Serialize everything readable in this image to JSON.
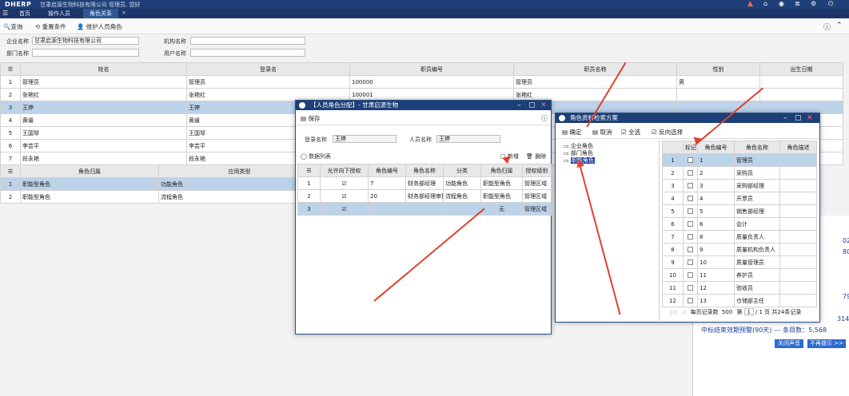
{
  "app": {
    "logo": "DHERP",
    "company": "甘肃启源生物科技有限公司",
    "user": "管理员, 您好"
  },
  "nav_tabs": [
    "首页",
    "操作人员",
    "角色关系"
  ],
  "toolbar": {
    "query": "查询",
    "reset": "重置条件",
    "maintain": "维护人员角色"
  },
  "filters": {
    "company_label": "企业名称",
    "company_value": "甘肃启源生物科技有限公司",
    "org_label": "机构名称",
    "dept_label": "部门名称",
    "user_label": "用户名称"
  },
  "staff_table": {
    "headers": [
      "姓名",
      "登录名",
      "职员编号",
      "职员名称",
      "性别",
      "出生日期"
    ],
    "rows": [
      {
        "n": "1",
        "name": "管理员",
        "login": "管理员",
        "code": "100000",
        "title": "管理员",
        "sex": "男"
      },
      {
        "n": "2",
        "name": "张艳红",
        "login": "张艳红",
        "code": "100001",
        "title": "张艳红",
        "sex": ""
      },
      {
        "n": "3",
        "name": "王婷",
        "login": "王婷",
        "code": "",
        "title": "",
        "sex": ""
      },
      {
        "n": "4",
        "name": "黄瑗",
        "login": "黄瑗",
        "code": "",
        "title": "",
        "sex": ""
      },
      {
        "n": "5",
        "name": "王国琴",
        "login": "王国琴",
        "code": "",
        "title": "",
        "sex": ""
      },
      {
        "n": "6",
        "name": "李芸平",
        "login": "李芸平",
        "code": "",
        "title": "",
        "sex": ""
      },
      {
        "n": "7",
        "name": "段永艳",
        "login": "段永艳",
        "code": "",
        "title": "",
        "sex": ""
      }
    ]
  },
  "role_table": {
    "headers": [
      "角色归属",
      "应用类型"
    ],
    "rows": [
      {
        "n": "1",
        "belong": "职能型角色",
        "app": "功能角色"
      },
      {
        "n": "2",
        "belong": "职能型角色",
        "app": "流程角色"
      }
    ]
  },
  "dialog1": {
    "title": "【人员角色分配】- 甘肃启源生物",
    "save": "保存",
    "login_label": "登录名称",
    "login_value": "王婷",
    "person_label": "人员名称",
    "person_value": "王婷",
    "list_label": "数据列表",
    "add": "新增",
    "del": "删除",
    "headers": [
      "允许向下授权",
      "角色编号",
      "角色名称",
      "分类",
      "角色归属",
      "授权级别"
    ],
    "rows": [
      {
        "n": "1",
        "check": "☑",
        "code": "7",
        "name": "财务部经理",
        "type": "功能角色",
        "belong": "职能型角色",
        "level": "管理区域"
      },
      {
        "n": "2",
        "check": "☑",
        "code": "20",
        "name": "财务部经理审批",
        "type": "流程角色",
        "belong": "职能型角色",
        "level": "管理区域"
      },
      {
        "n": "3",
        "check": "☑",
        "code": "",
        "name": "",
        "type": "",
        "belong": "无",
        "level": "管理区域"
      }
    ]
  },
  "dialog2": {
    "title": "角色资料检索方案",
    "ok": "确定",
    "cancel": "取消",
    "all": "全选",
    "invert": "反向选择",
    "tree": [
      "企业角色",
      "部门角色",
      "职能角色"
    ],
    "headers": [
      "标记",
      "角色编号",
      "角色名称",
      "角色描述"
    ],
    "rows": [
      {
        "n": "1",
        "code": "1",
        "name": "管理员"
      },
      {
        "n": "2",
        "code": "2",
        "name": "采购员"
      },
      {
        "n": "3",
        "code": "3",
        "name": "采购部经理"
      },
      {
        "n": "4",
        "code": "4",
        "name": "开票员"
      },
      {
        "n": "5",
        "code": "5",
        "name": "销售部经理"
      },
      {
        "n": "6",
        "code": "6",
        "name": "会计"
      },
      {
        "n": "7",
        "code": "8",
        "name": "质量负责人"
      },
      {
        "n": "8",
        "code": "9",
        "name": "质量机构负责人"
      },
      {
        "n": "9",
        "code": "10",
        "name": "质量管理员"
      },
      {
        "n": "10",
        "code": "11",
        "name": "养护员"
      },
      {
        "n": "11",
        "code": "12",
        "name": "验收员"
      },
      {
        "n": "12",
        "code": "13",
        "name": "仓储部主任"
      }
    ],
    "pager": {
      "per_page_label": "每页记录数",
      "per_page": "500",
      "page_prefix": "第",
      "page": "1",
      "page_suffix": "/ 1 页",
      "total": "共24条记录"
    }
  },
  "notice": {
    "nums": [
      "02",
      "80",
      "79",
      "314"
    ],
    "line": "中标结束效期预警(90天) --- 条目数：5,568",
    "close_sound": "关闭声音",
    "no_remind": "不再提示 >>"
  },
  "colors": {
    "header": "#1f3f78",
    "selected": "#bcd3ea",
    "arrow": "#e0402e"
  }
}
